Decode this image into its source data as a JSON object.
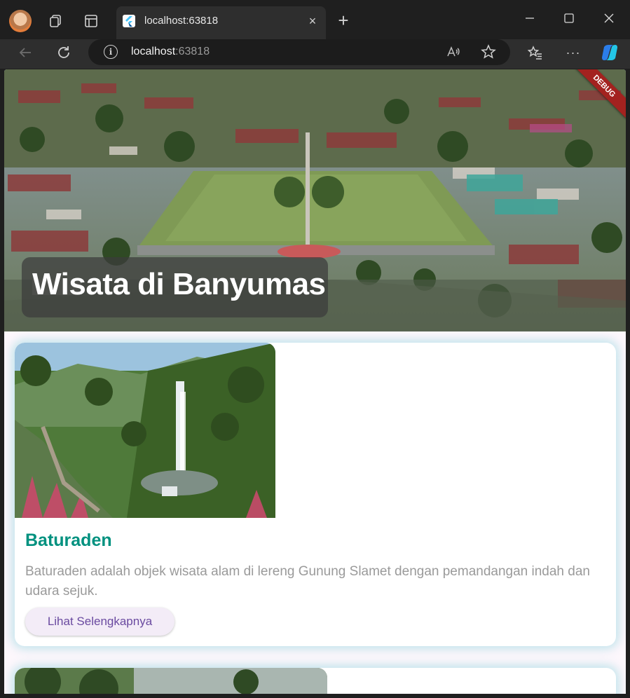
{
  "browser": {
    "tab_title": "localhost:63818",
    "url_host": "localhost",
    "url_port": ":63818",
    "close_glyph": "×",
    "new_tab_glyph": "+",
    "menu_glyph": "···"
  },
  "hero": {
    "title": "Wisata di Banyumas",
    "debug_label": "DEBUG"
  },
  "destinations": [
    {
      "name": "Baturaden",
      "description": "Baturaden adalah objek wisata alam di lereng Gunung Slamet dengan pemandangan indah dan udara sejuk.",
      "button_label": "Lihat Selengkapnya"
    }
  ],
  "colors": {
    "accent_title": "#00917f",
    "button_text": "#6a4aa0",
    "debug_banner": "#a3221f"
  }
}
